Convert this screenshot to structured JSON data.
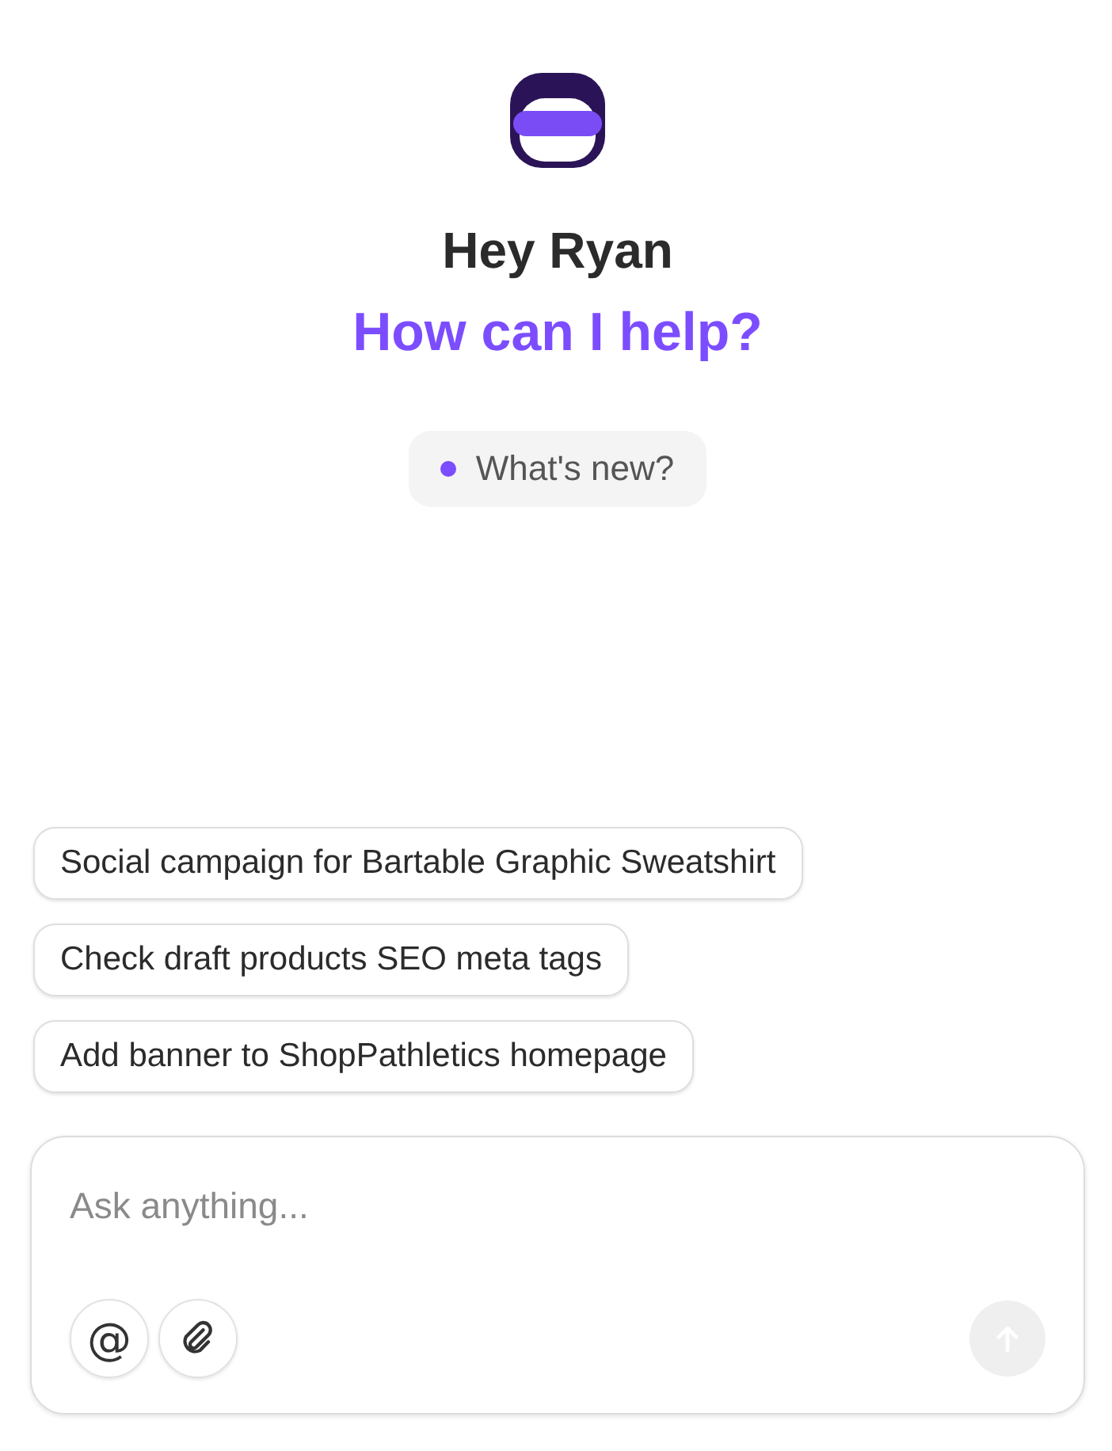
{
  "greeting": "Hey Ryan",
  "headline": "How can I help?",
  "whats_new": {
    "label": "What's new?",
    "unread": true
  },
  "suggestions": [
    "Social campaign for Bartable Graphic Sweatshirt",
    "Check draft products SEO meta tags",
    "Add banner to ShopPathletics homepage"
  ],
  "composer": {
    "placeholder": "Ask anything...",
    "mention": "@",
    "send_disabled": true
  }
}
